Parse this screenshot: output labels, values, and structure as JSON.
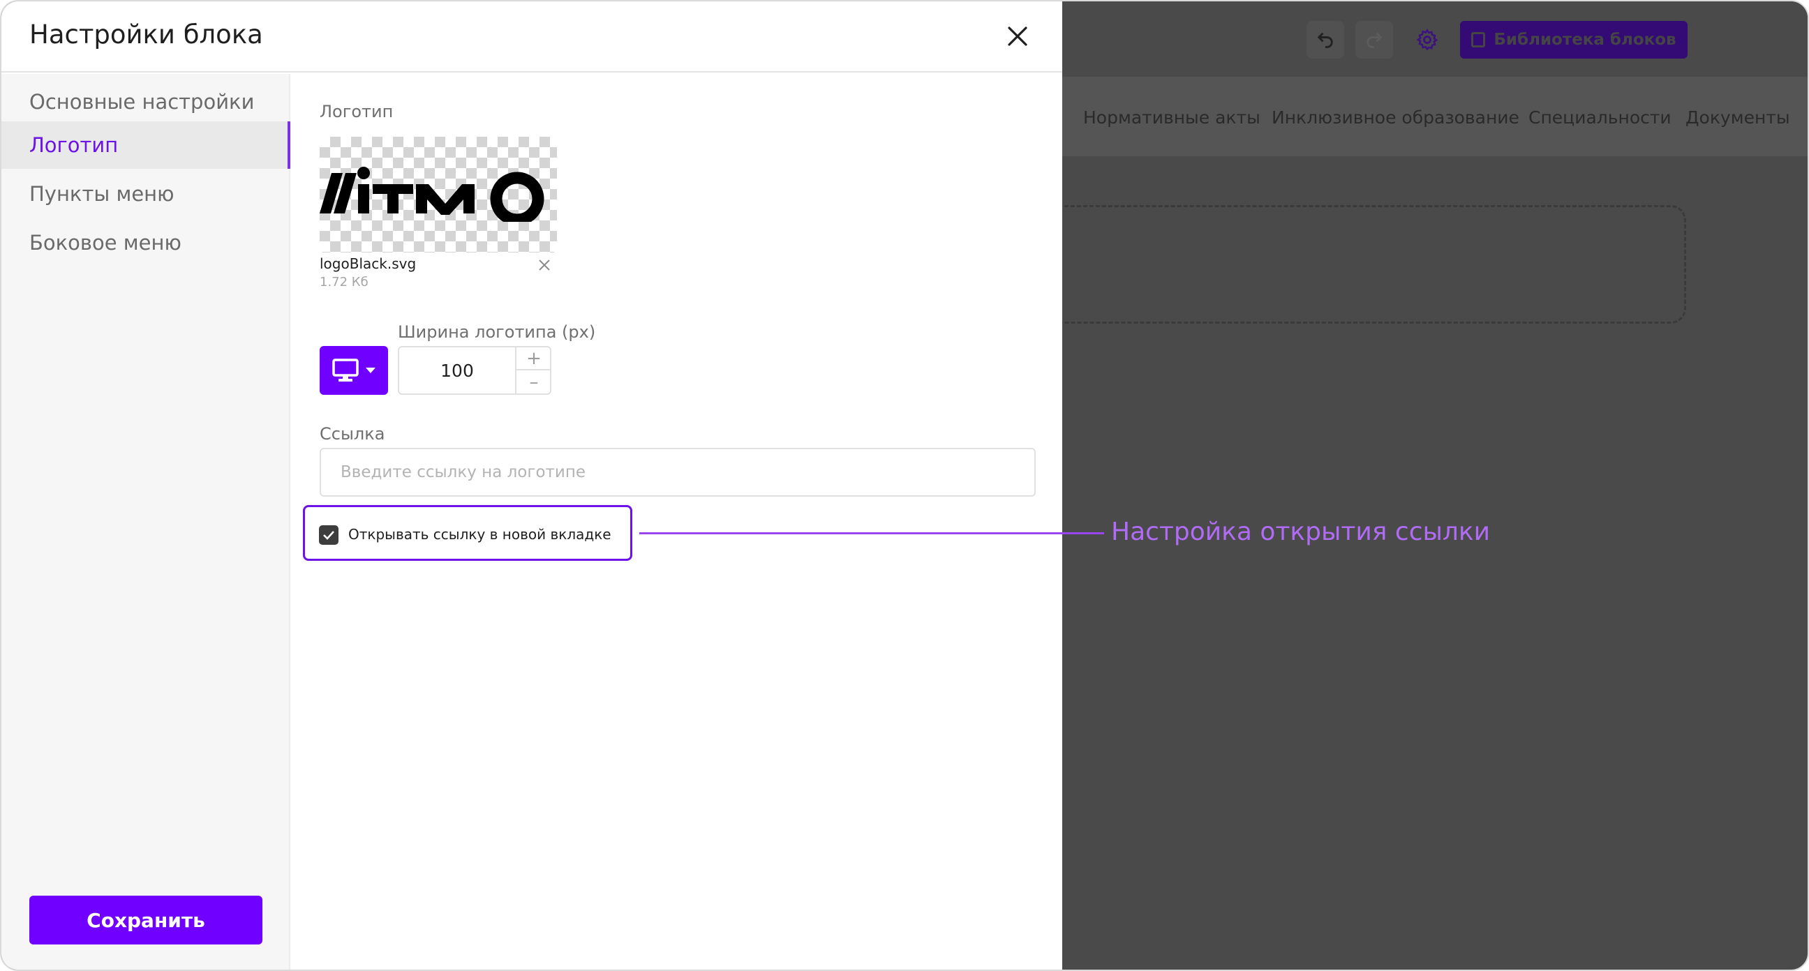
{
  "dialog": {
    "title": "Настройки блока",
    "sidebar": {
      "items": [
        {
          "label": "Основные настройки"
        },
        {
          "label": "Логотип"
        },
        {
          "label": "Пункты меню"
        },
        {
          "label": "Боковое меню"
        }
      ],
      "active_index": 1,
      "save_label": "Сохранить"
    },
    "logo": {
      "section_label": "Логотип",
      "preview_text": "ИТМО",
      "file_name": "logoBlack.svg",
      "file_size": "1.72 Кб"
    },
    "width": {
      "label": "Ширина логотипа (px)",
      "device": "desktop-icon",
      "value": "100"
    },
    "link": {
      "label": "Ссылка",
      "value": "",
      "placeholder": "Введите ссылку на логотипе"
    },
    "new_tab": {
      "checked": true,
      "label": "Открывать ссылку в новой вкладке"
    }
  },
  "background": {
    "library_button": "Библиотека блоков",
    "nav_items": [
      "Нормативные акты",
      "Инклюзивное образование",
      "Специальности",
      "Документы"
    ]
  },
  "annotation": {
    "text": "Настройка открытия ссылки"
  },
  "colors": {
    "accent": "#7000ff",
    "annotation": "#b06cf5",
    "overlay": "#4a4a4a"
  }
}
